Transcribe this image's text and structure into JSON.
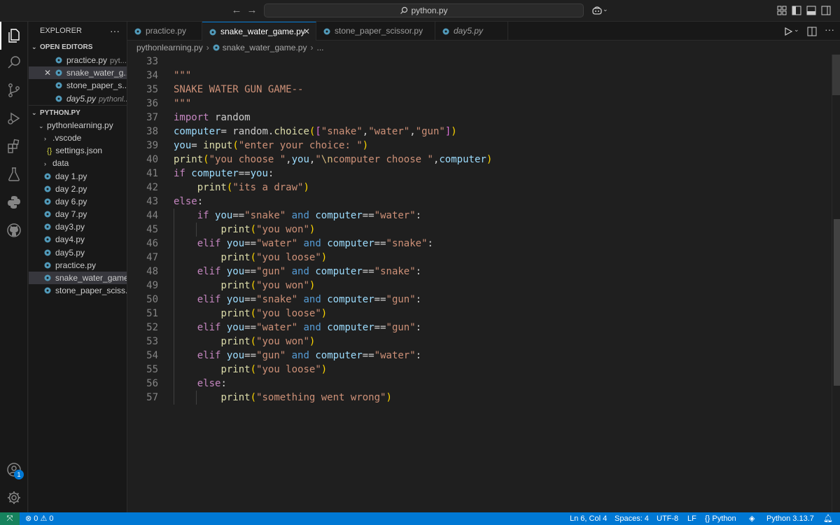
{
  "titlebar": {
    "search_text": "python.py"
  },
  "explorer": {
    "title": "EXPLORER",
    "open_editors_title": "OPEN EDITORS",
    "open_editors": [
      {
        "name": "practice.py",
        "desc": "pyt..."
      },
      {
        "name": "snake_water_g...",
        "desc": ""
      },
      {
        "name": "stone_paper_s...",
        "desc": ""
      },
      {
        "name": "day5.py",
        "desc": "pythonl..."
      }
    ],
    "folder_title": "PYTHON.PY",
    "subfolder": "pythonlearning.py",
    "vscode_folder": ".vscode",
    "settings_file": "settings.json",
    "files": [
      "data",
      "day 1.py",
      "day 2.py",
      "day 6.py",
      "day 7.py",
      "day3.py",
      "day4.py",
      "day5.py",
      "practice.py",
      "snake_water_game...",
      "stone_paper_sciss..."
    ]
  },
  "tabs": [
    {
      "label": "practice.py"
    },
    {
      "label": "snake_water_game.py"
    },
    {
      "label": "stone_paper_scissor.py"
    },
    {
      "label": "day5.py"
    }
  ],
  "breadcrumb": {
    "folder": "pythonlearning.py",
    "file": "snake_water_game.py",
    "more": "..."
  },
  "editor": {
    "line_numbers": [
      "33",
      "34",
      "35",
      "36",
      "37",
      "38",
      "39",
      "40",
      "41",
      "42",
      "43",
      "44",
      "45",
      "46",
      "47",
      "48",
      "49",
      "50",
      "51",
      "52",
      "53",
      "54",
      "55",
      "56",
      "57"
    ],
    "t": {
      "q3": "\"\"\"",
      "title": "SNAKE WATER GUN GAME--",
      "import": "import",
      "random": "random",
      "computer": "computer",
      "eq": "= ",
      "random_dot": "random.",
      "choice": "choice",
      "lp": "(",
      "rp": ")",
      "lb": "[",
      "rb": "]",
      "comma": ",",
      "s_snake": "\"snake\"",
      "s_water": "\"water\"",
      "s_gun": "\"gun\"",
      "you": "you",
      "input": "input",
      "s_enter": "\"enter your choice: \"",
      "print": "print",
      "s_you_choose": "\"you choose \"",
      "s_quote": "\"",
      "esc_n": "\\n",
      "s_comp_choose": "computer choose \"",
      "if": "if",
      "eqeq": "==",
      "colon": ":",
      "s_draw": "\"its a draw\"",
      "else": "else",
      "and": "and",
      "elif": "elif",
      "s_won": "\"you won\"",
      "s_loose": "\"you loose\"",
      "s_wrong": "\"something went wrong\""
    }
  },
  "status": {
    "errors": "0",
    "warnings": "0",
    "position": "Ln 6, Col 4",
    "spaces": "Spaces: 4",
    "encoding": "UTF-8",
    "eol": "LF",
    "language": "Python",
    "interpreter": "Python 3.13.7"
  },
  "badges": {
    "accounts": "1"
  },
  "colors": {
    "accent": "#0078d4",
    "background": "#1f1f1f",
    "sidebar": "#181818"
  }
}
